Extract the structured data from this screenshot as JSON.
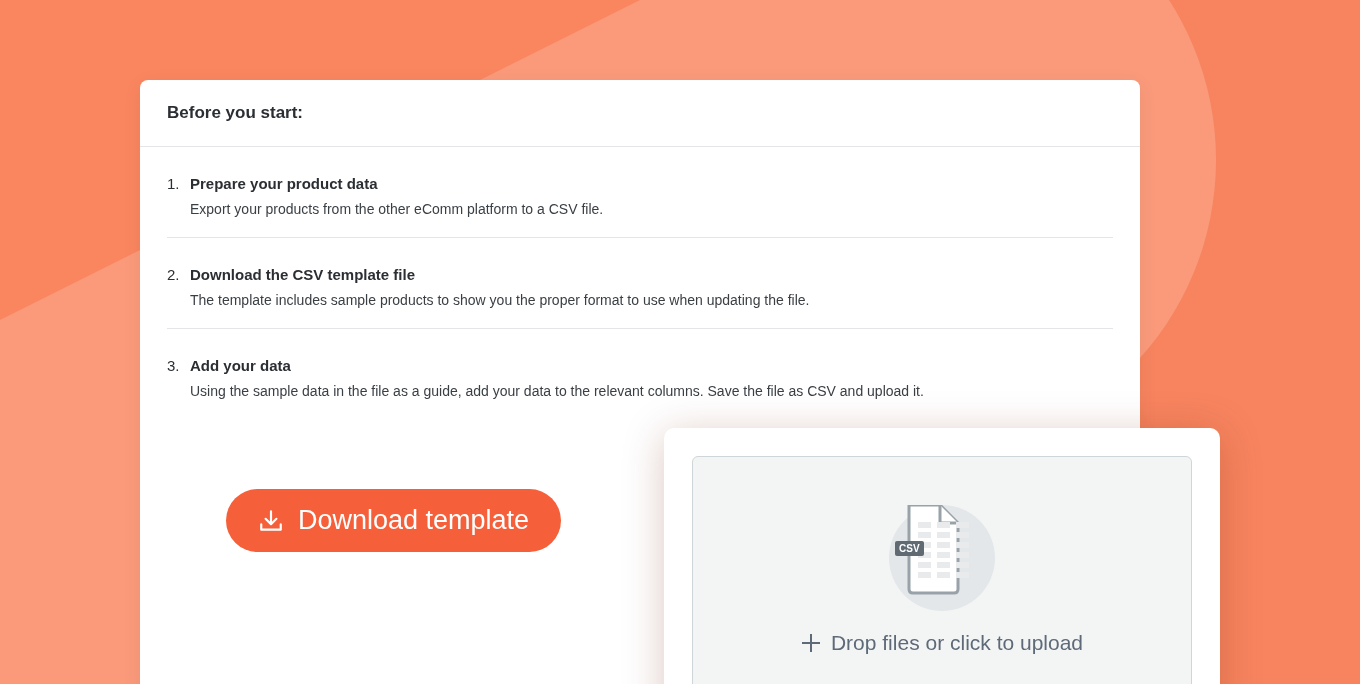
{
  "card": {
    "title": "Before you start:"
  },
  "steps": [
    {
      "number": "1.",
      "title": "Prepare your product data",
      "description": "Export your products from the other eComm platform to a CSV file."
    },
    {
      "number": "2.",
      "title": "Download the CSV template file",
      "description": "The template includes sample products to show you the proper format to use when updating the file."
    },
    {
      "number": "3.",
      "title": "Add your data",
      "description": "Using the sample data in the file as a guide, add your data to the relevant columns. Save the file as CSV and upload it."
    }
  ],
  "download_button": {
    "label": "Download template"
  },
  "upload": {
    "file_badge": "CSV",
    "prompt": "Drop files or click to upload"
  }
}
